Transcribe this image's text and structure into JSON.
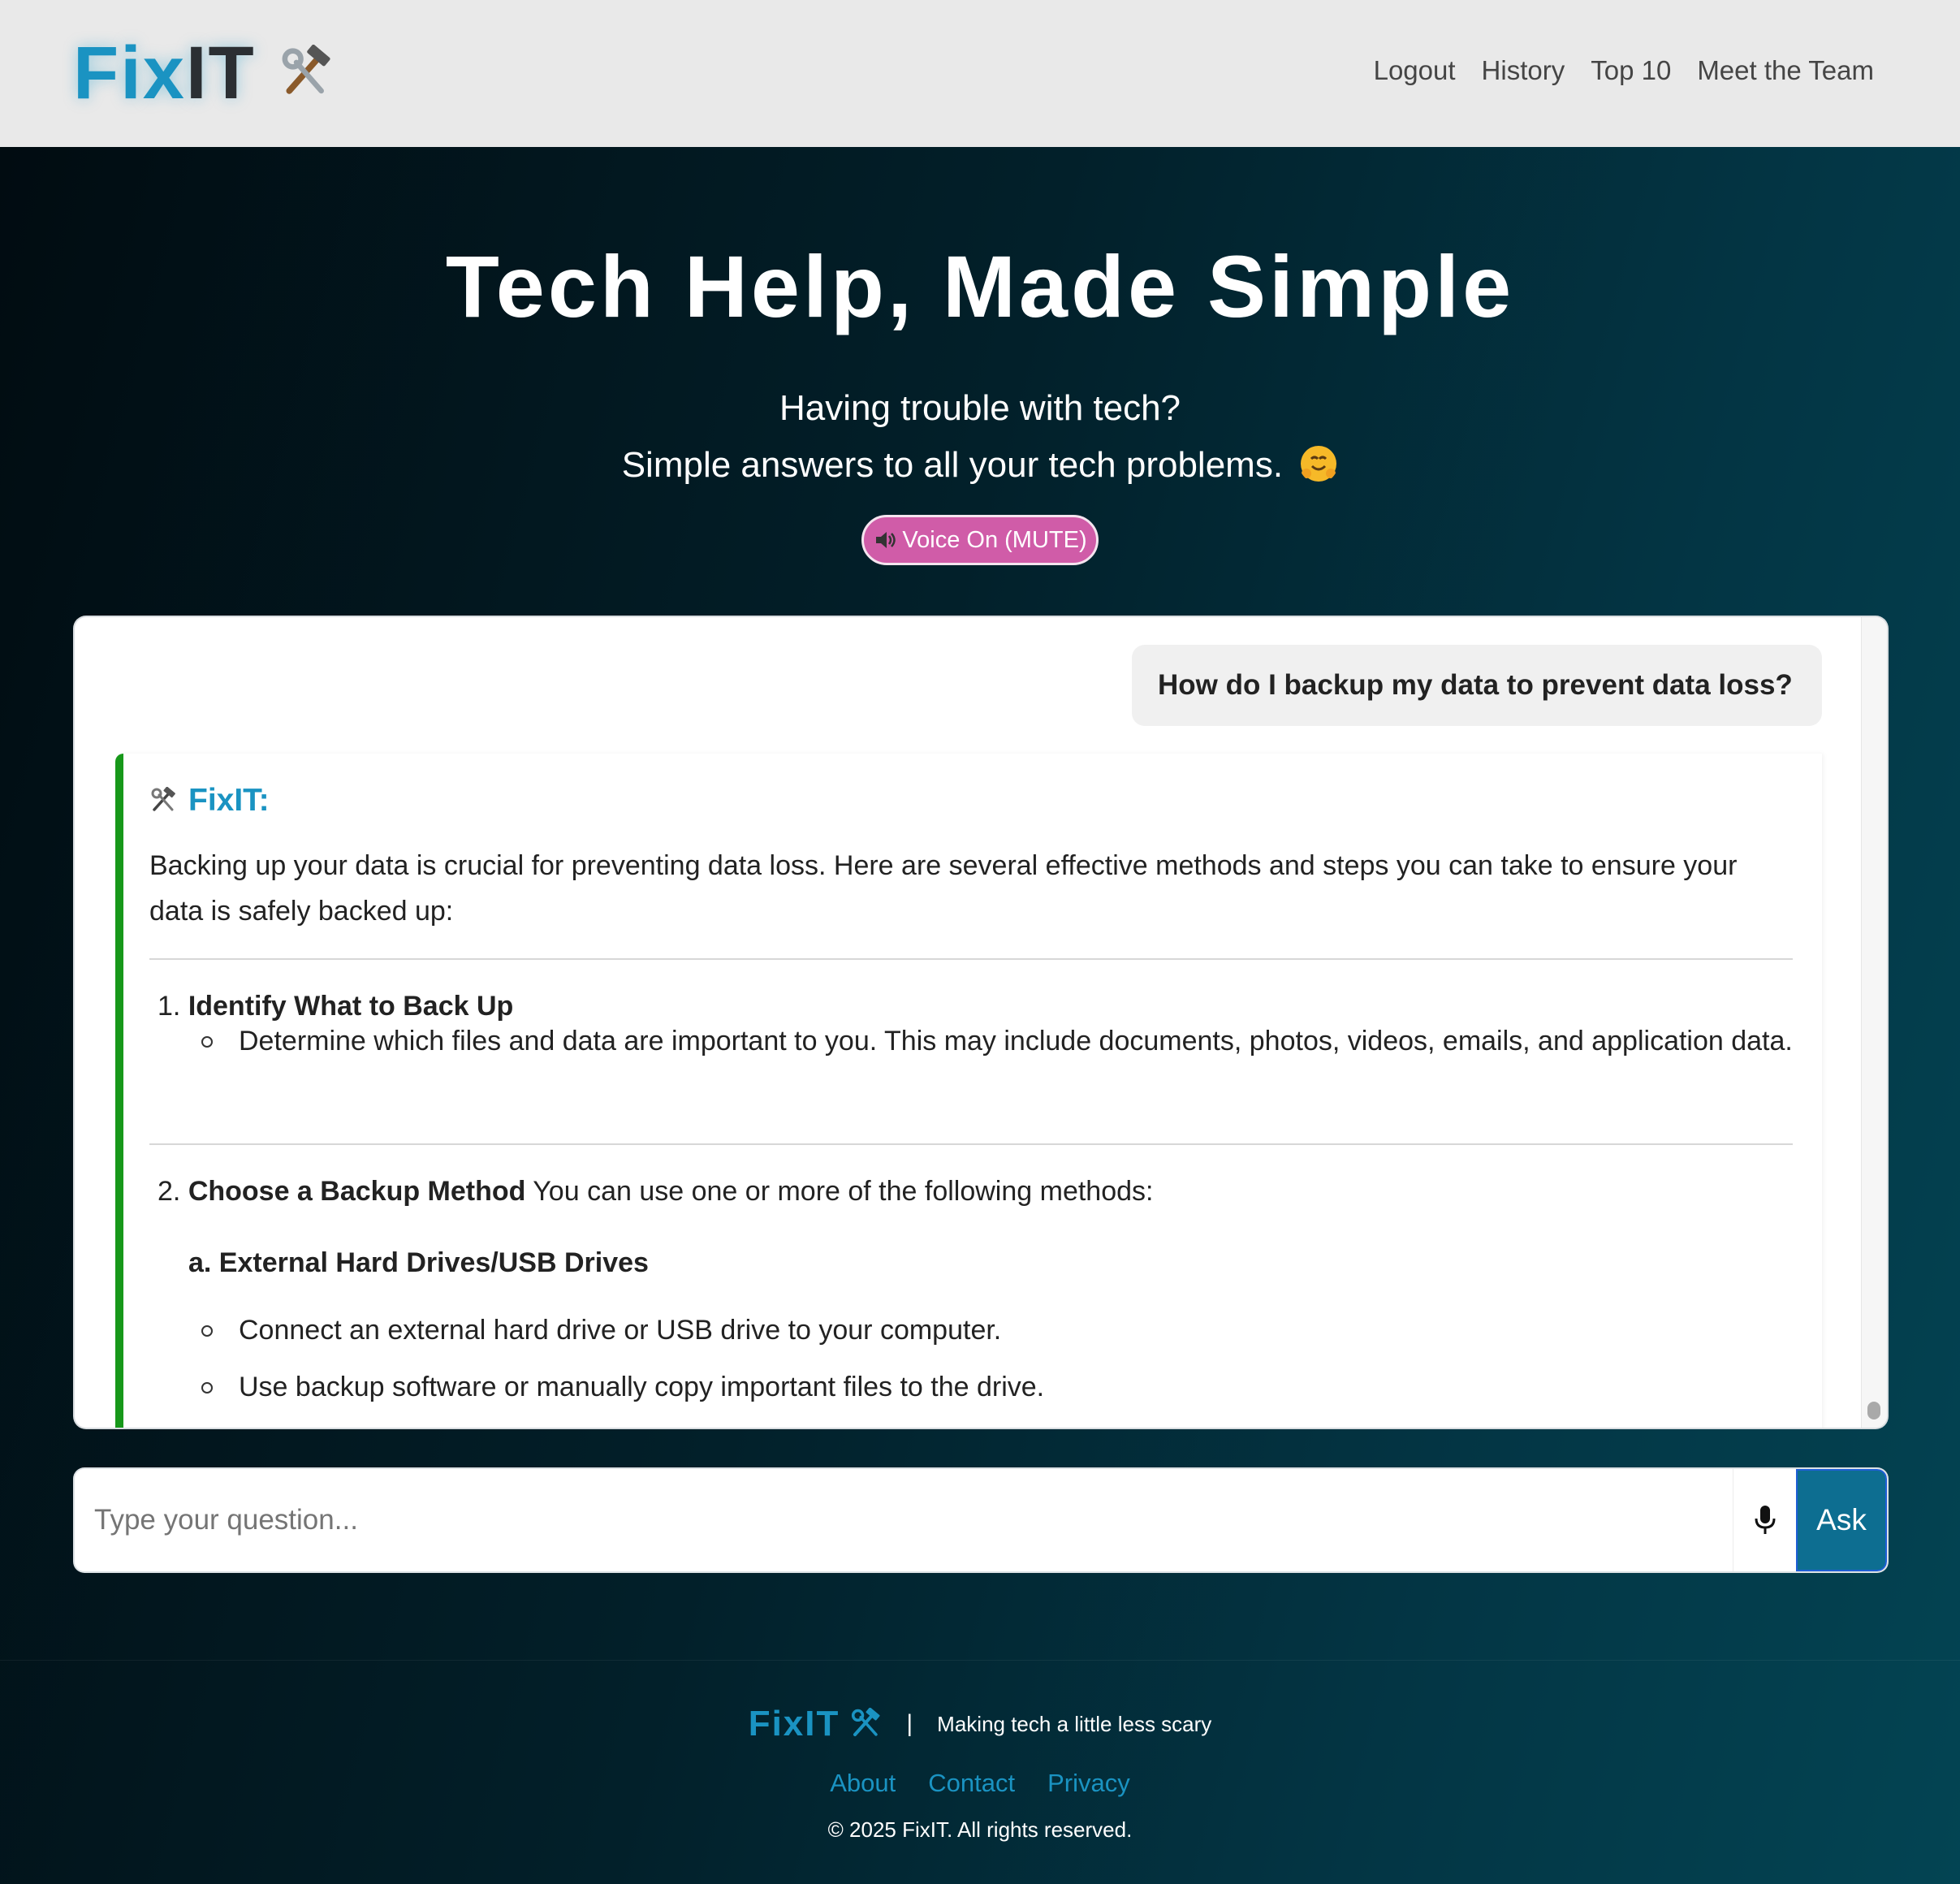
{
  "header": {
    "logo_fix": "Fix",
    "logo_it": "IT",
    "nav": [
      "Logout",
      "History",
      "Top 10",
      "Meet the Team"
    ]
  },
  "hero": {
    "title": "Tech Help, Made Simple",
    "subtitle_line1": "Having trouble with tech?",
    "subtitle_line2": "Simple answers to all your tech problems.",
    "voice_button": "Voice On (MUTE)"
  },
  "chat": {
    "user_message": "How do I backup my data to prevent data loss?",
    "bot_name": "FixIT:",
    "intro": "Backing up your data is crucial for preventing data loss. Here are several effective methods and steps you can take to ensure your data is safely backed up:",
    "step1_num": "1.",
    "step1_title": "Identify What to Back Up",
    "step1_bullet": "Determine which files and data are important to you. This may include documents, photos, videos, emails, and application data.",
    "step2_num": "2.",
    "step2_title": "Choose a Backup Method",
    "step2_rest": " You can use one or more of the following methods:",
    "sub_a": "a. External Hard Drives/USB Drives",
    "sub_a_bullets": [
      "Connect an external hard drive or USB drive to your computer.",
      "Use backup software or manually copy important files to the drive."
    ]
  },
  "input": {
    "placeholder": "Type your question...",
    "ask_label": "Ask"
  },
  "footer": {
    "logo": "FixIT",
    "separator": "|",
    "tagline": "Making tech a little less scary",
    "links": [
      "About",
      "Contact",
      "Privacy"
    ],
    "copyright": "© 2025 FixIT. All rights reserved."
  },
  "colors": {
    "brand": "#1a93c2",
    "voice_button": "#d05ca8",
    "bot_border": "#17981a",
    "ask_button": "#0d6e91"
  },
  "icons": [
    "tools-icon",
    "smile-hug-icon",
    "speaker-icon",
    "microphone-icon"
  ]
}
